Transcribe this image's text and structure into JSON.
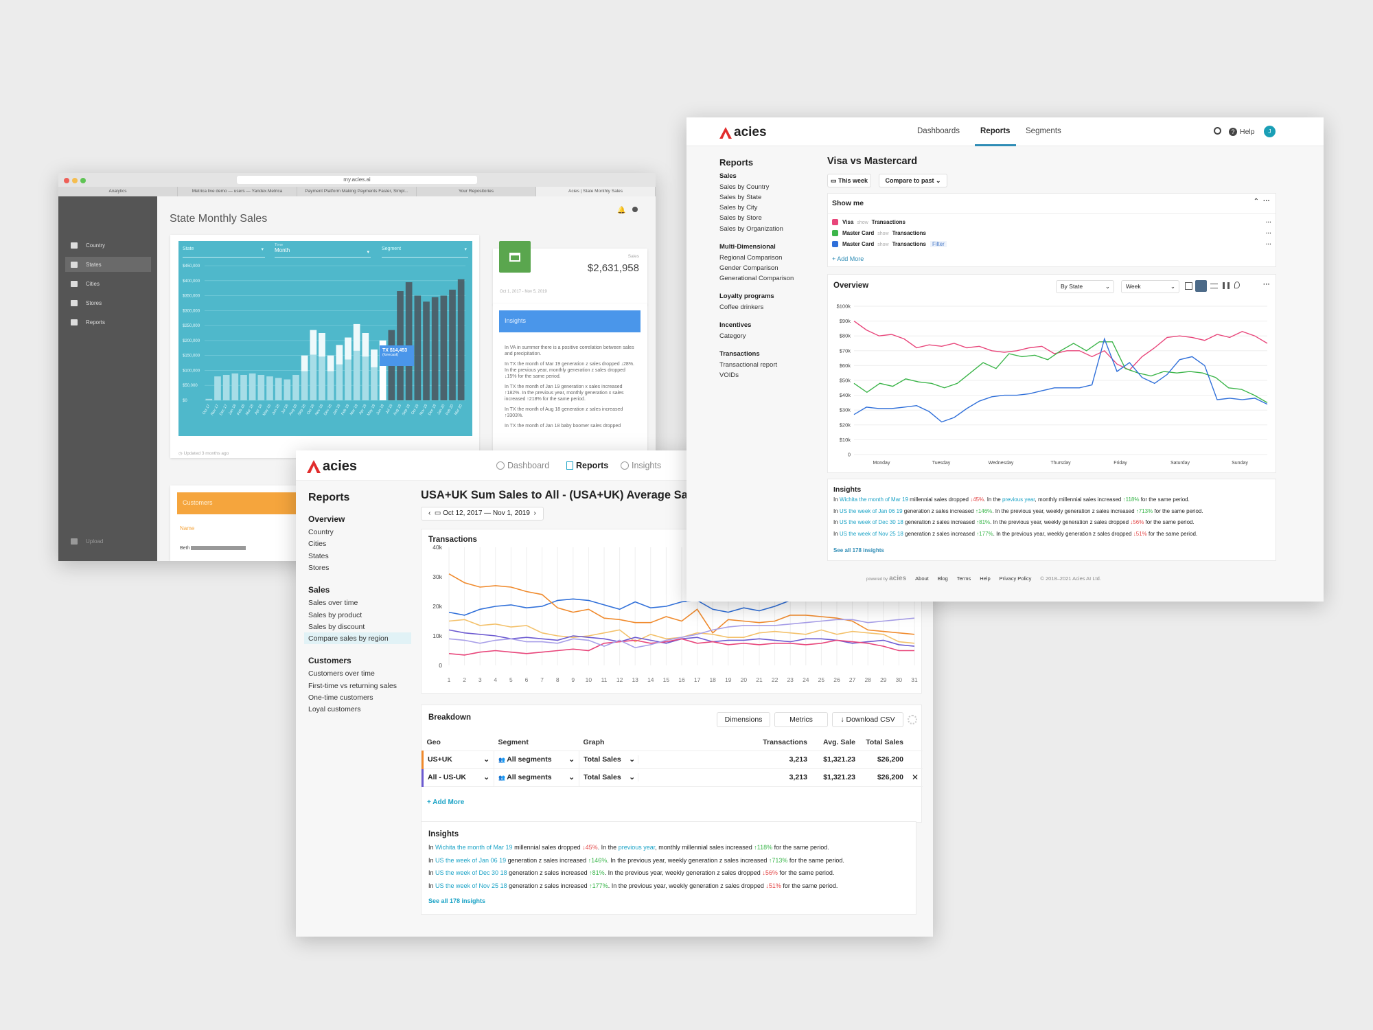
{
  "palette": {
    "pink": "#e8457a",
    "green": "#3cb54a",
    "blue": "#2f6fd9",
    "orange": "#f08a2c",
    "purple": "#6c5ad1",
    "teal": "#4fb8cb",
    "insight_blue": "#4a96ea",
    "customers_orange": "#f5a53d"
  },
  "win1": {
    "url": "my.acies.ai",
    "tabs": [
      "Analytics",
      "Metrica live demo — users — Yandex.Metrica",
      "Payment Platform Making Payments Faster, Simpl...",
      "Your Repositories",
      "Acies | State Monthly Sales"
    ],
    "nav": [
      {
        "label": "Country",
        "icon": "flag-icon"
      },
      {
        "label": "States",
        "icon": "map-icon"
      },
      {
        "label": "Cities",
        "icon": "city-icon"
      },
      {
        "label": "Stores",
        "icon": "store-icon"
      },
      {
        "label": "Reports",
        "icon": "report-icon"
      }
    ],
    "upload": "Upload",
    "title": "State Monthly Sales",
    "filters": {
      "state": "State",
      "time_label": "Time",
      "time_value": "Month",
      "segment": "Segment"
    },
    "tooltip": {
      "value": "TX $14,453",
      "note": "(forecast)"
    },
    "sales": {
      "label": "Sales",
      "value": "$2,631,958",
      "range": "Oct 1, 2017 - Nov 5, 2019"
    },
    "updated": "Updated 3 months ago",
    "insights_title": "Insights",
    "insights": [
      "In VA in summer there is a positive correlation between sales and precipitation.",
      "In TX the month of Mar 19 generation z sales dropped ↓28%. In the previous year, monthly generation z sales dropped ↓15% for the same period.",
      "In TX the month of Jan 19 generation x sales increased ↑182%. In the previous year, monthly generation x sales increased ↑218% for the same period.",
      "In TX the month of Aug 18 generation z sales increased ↑3303%.",
      "In TX the month of Jan 18 baby boomer sales dropped"
    ],
    "customers_title": "Customers",
    "customers_col": "Name",
    "customers_row": "Beth"
  },
  "win1_chart": {
    "chart_data": {
      "type": "bar",
      "ylim": [
        0,
        450000
      ],
      "yticks": [
        "$0",
        "$50,000",
        "$100,000",
        "$150,000",
        "$200,000",
        "$250,000",
        "$300,000",
        "$350,000",
        "$400,000",
        "$450,000"
      ],
      "categories": [
        "Oct 17",
        "Nov 17",
        "Dec 17",
        "Jan 18",
        "Feb 18",
        "Mar 18",
        "Apr 18",
        "May 18",
        "Jun 18",
        "Jul 18",
        "Aug 18",
        "Sep 18",
        "Oct 18",
        "Nov 18",
        "Dec 18",
        "Jan 19",
        "Feb 19",
        "Mar 19",
        "Apr 19",
        "May 19",
        "Jun 19",
        "Jul 19",
        "Aug 19",
        "Sep 19",
        "Oct 19",
        "Nov 19",
        "Dec 19",
        "Jan 20",
        "Feb 20",
        "Mar 20"
      ],
      "values": [
        5000,
        80000,
        85000,
        90000,
        85000,
        90000,
        85000,
        80000,
        75000,
        70000,
        85000,
        150000,
        235000,
        225000,
        150000,
        185000,
        210000,
        255000,
        225000,
        170000,
        200000,
        235000,
        365000,
        395000,
        350000,
        330000,
        345000,
        350000,
        370000,
        405000
      ]
    }
  },
  "win2": {
    "brand": "acies",
    "nav": [
      "Dashboard",
      "Reports",
      "Insights"
    ],
    "side": {
      "title": "Reports",
      "overview": "Overview",
      "overview_items": [
        "Country",
        "Cities",
        "States",
        "Stores"
      ],
      "sales": "Sales",
      "sales_items": [
        "Sales over time",
        "Sales by product",
        "Sales by discount",
        "Compare sales by region"
      ],
      "customers": "Customers",
      "customers_items": [
        "Customers over time",
        "First-time vs returning sales",
        "One-time customers",
        "Loyal customers"
      ]
    },
    "title": "USA+UK Sum Sales to All - (USA+UK) Average Sales",
    "date_range": "Oct 12, 2017 — Nov 1, 2019",
    "transactions_title": "Transactions",
    "breakdown_title": "Breakdown",
    "buttons": {
      "dimensions": "Dimensions",
      "metrics": "Metrics",
      "csv": "Download CSV"
    },
    "table": {
      "headers": [
        "Geo",
        "Segment",
        "Graph",
        "Transactions",
        "Avg. Sale",
        "Total Sales"
      ],
      "rows": [
        {
          "geo": "US+UK",
          "segment": "All segments",
          "graph": "Total Sales",
          "transactions": "3,213",
          "avg": "$1,321.23",
          "total": "$26,200"
        },
        {
          "geo": "All - US-UK",
          "segment": "All segments",
          "graph": "Total Sales",
          "transactions": "3,213",
          "avg": "$1,321.23",
          "total": "$26,200"
        }
      ],
      "add_more": "+ Add More"
    },
    "insights_title": "Insights",
    "insights": [
      [
        "In ",
        "Wichita the month of Mar 19",
        " millennial sales dropped ",
        "↓45%",
        ". In the ",
        "previous year",
        ", monthly millennial sales increased ",
        "↑118%",
        " for the same period."
      ],
      [
        "In ",
        "US the week of Jan 06 19",
        " generation z sales increased ",
        "↑146%",
        ". In the previous year, weekly generation z sales increased ",
        "",
        "",
        "↑713%",
        " for the same period."
      ],
      [
        "In ",
        "US the week of Dec 30 18",
        " generation z sales increased ",
        "↑81%",
        ". In the previous year, weekly generation z sales dropped ",
        "",
        "",
        "↓56%",
        " for the same period."
      ],
      [
        "In ",
        "US the week of Nov 25 18",
        " generation z sales increased ",
        "↑177%",
        ". In the previous year, weekly generation z sales dropped ",
        "",
        "",
        "↓51%",
        " for the same period."
      ]
    ],
    "see_all": "See all 178 insights"
  },
  "win2_chart": {
    "chart_data": {
      "type": "line",
      "x": [
        1,
        2,
        3,
        4,
        5,
        6,
        7,
        8,
        9,
        10,
        11,
        12,
        13,
        14,
        15,
        16,
        17,
        18,
        19,
        20,
        21,
        22,
        23,
        24,
        25,
        26,
        27,
        28,
        29,
        30,
        31
      ],
      "ylim": [
        0,
        40000
      ],
      "yticks": [
        "0",
        "10k",
        "20k",
        "30k",
        "40k"
      ],
      "series": [
        {
          "color": "#2f6fd9",
          "values": [
            18000,
            17000,
            19000,
            20000,
            20500,
            19500,
            20000,
            22000,
            22500,
            22000,
            20500,
            19000,
            21500,
            19500,
            20000,
            21500,
            22000,
            19000,
            18000,
            19500,
            18500,
            20000,
            22000,
            24500,
            23000,
            25000,
            28000,
            29500,
            30000,
            30500,
            31000
          ]
        },
        {
          "color": "#f08a2c",
          "values": [
            31000,
            28000,
            26500,
            27000,
            26500,
            25000,
            24000,
            19500,
            18000,
            19000,
            16000,
            15500,
            14500,
            14500,
            16500,
            15000,
            19000,
            11000,
            15500,
            15000,
            14500,
            15000,
            17000,
            17000,
            16500,
            16000,
            15000,
            12000,
            11500,
            11000,
            10500
          ]
        },
        {
          "color": "#f3c16b",
          "values": [
            15000,
            15500,
            13500,
            14000,
            13000,
            13500,
            11000,
            10000,
            9500,
            10000,
            11000,
            12000,
            8000,
            10500,
            9000,
            9500,
            11000,
            10500,
            9500,
            9500,
            11000,
            11500,
            11000,
            10500,
            12000,
            10500,
            11500,
            11000,
            10500,
            8000,
            7500
          ]
        },
        {
          "color": "#6c5ad1",
          "values": [
            12000,
            11000,
            10500,
            10000,
            9000,
            9500,
            9000,
            8500,
            10000,
            9500,
            9000,
            8000,
            9500,
            8500,
            7500,
            9000,
            9500,
            8000,
            8500,
            8500,
            9000,
            8500,
            8000,
            9000,
            9000,
            8500,
            7500,
            8000,
            8500,
            7000,
            6500
          ]
        },
        {
          "color": "#e8457a",
          "values": [
            4000,
            3500,
            4500,
            5000,
            4500,
            4000,
            4500,
            5000,
            5500,
            5000,
            7500,
            8000,
            8500,
            7500,
            8000,
            9000,
            7500,
            8000,
            7000,
            7500,
            7000,
            7500,
            7500,
            7000,
            7500,
            8500,
            8000,
            7500,
            6500,
            5000,
            5000
          ]
        },
        {
          "color": "#a79ee8",
          "values": [
            9000,
            8500,
            7500,
            8500,
            9000,
            8000,
            8000,
            7500,
            9000,
            8500,
            6500,
            8500,
            6000,
            7000,
            8500,
            9500,
            10500,
            12000,
            13000,
            13500,
            13500,
            13500,
            14000,
            14500,
            15000,
            15500,
            15500,
            14500,
            15000,
            15500,
            16000
          ]
        }
      ]
    }
  },
  "win3": {
    "brand": "acies",
    "nav": [
      "Dashboards",
      "Reports",
      "Segments"
    ],
    "help": "Help",
    "avatar": "J",
    "side": {
      "title": "Reports",
      "groups": [
        {
          "title": "Sales",
          "items": [
            "Sales by Country",
            "Sales by State",
            "Sales by City",
            "Sales by Store",
            "Sales by Organization"
          ]
        },
        {
          "title": "Multi-Dimensional",
          "items": [
            "Regional Comparison",
            "Gender Comparison",
            "Generational Comparison"
          ]
        },
        {
          "title": "Loyalty programs",
          "items": [
            "Coffee drinkers"
          ]
        },
        {
          "title": "Incentives",
          "items": [
            "Category"
          ]
        },
        {
          "title": "Transactions",
          "items": [
            "Transactional report",
            "VOIDs"
          ]
        }
      ]
    },
    "title": "Visa vs Mastercard",
    "this_week": "This week",
    "compare": "Compare to past",
    "show_me": "Show me",
    "rows": [
      {
        "name": "Visa",
        "show": "show",
        "metric": "Transactions",
        "filter": "",
        "color": "#e8457a"
      },
      {
        "name": "Master Card",
        "show": "show",
        "metric": "Transactions",
        "filter": "",
        "color": "#3cb54a"
      },
      {
        "name": "Master Card",
        "show": "show",
        "metric": "Transactions",
        "filter": "Filter",
        "color": "#2f6fd9"
      }
    ],
    "add_more": "+ Add More",
    "overview": "Overview",
    "by_state": "By State",
    "week": "Week",
    "insights_title": "Insights",
    "see_all": "See all 178 insights",
    "footer": {
      "powered": "powered by",
      "links": [
        "About",
        "Blog",
        "Terms",
        "Help",
        "Privacy Policy"
      ],
      "copy": "© 2018–2021 Acies AI Ltd."
    }
  },
  "win3_chart": {
    "chart_data": {
      "type": "line",
      "x_labels": [
        "Monday",
        "Tuesday",
        "Wednesday",
        "Thursday",
        "Friday",
        "Saturday",
        "Sunday"
      ],
      "ylim": [
        0,
        100000
      ],
      "yticks": [
        "0",
        "$10k",
        "$20k",
        "$30k",
        "$40k",
        "$50k",
        "$60k",
        "$70k",
        "$80k",
        "$90k",
        "$100k"
      ],
      "series": [
        {
          "color": "#e8457a",
          "values": [
            90000,
            84000,
            80000,
            81000,
            78000,
            72000,
            74000,
            73000,
            75000,
            72000,
            73000,
            70000,
            69000,
            70000,
            72000,
            73000,
            68000,
            70000,
            70000,
            66000,
            70000,
            61000,
            57000,
            66000,
            72000,
            79000,
            80000,
            79000,
            77000,
            81000,
            79000,
            83000,
            80000,
            75000
          ]
        },
        {
          "color": "#3cb54a",
          "values": [
            48000,
            42000,
            48000,
            46000,
            51000,
            49000,
            48000,
            45000,
            48000,
            55000,
            62000,
            58000,
            68000,
            66000,
            67000,
            64000,
            70000,
            75000,
            70000,
            76000,
            76000,
            58000,
            55000,
            53000,
            56000,
            55000,
            56000,
            55000,
            52000,
            45000,
            44000,
            40000,
            35000
          ]
        },
        {
          "color": "#2f6fd9",
          "values": [
            27000,
            32000,
            31000,
            31000,
            32000,
            33000,
            29000,
            22000,
            25000,
            31000,
            36000,
            39000,
            40000,
            40000,
            41000,
            43000,
            45000,
            45000,
            45000,
            47000,
            78000,
            56000,
            62000,
            52000,
            48000,
            54000,
            64000,
            66000,
            60000,
            37000,
            38000,
            37000,
            38000,
            34000
          ]
        }
      ]
    }
  },
  "win3_insights": [
    [
      "In ",
      "Wichita the month of Mar 19",
      " millennial sales dropped ",
      "↓45%",
      ". In the ",
      "previous year",
      ", monthly millennial sales increased ",
      "↑118%",
      " for the same period."
    ],
    [
      "In ",
      "US the week of Jan 06 19",
      " generation z sales increased ",
      "↑146%",
      ". In the previous year, weekly generation z sales increased ",
      "",
      "",
      "↑713%",
      " for the same period."
    ],
    [
      "In ",
      "US the week of Dec 30 18",
      " generation z sales increased ",
      "↑81%",
      ". In the previous year, weekly generation z sales dropped ",
      "",
      "",
      "↓56%",
      " for the same period."
    ],
    [
      "In ",
      "US the week of Nov 25 18",
      " generation z sales increased ",
      "↑177%",
      ". In the previous year, weekly generation z sales dropped ",
      "",
      "",
      "↓51%",
      " for the same period."
    ]
  ]
}
